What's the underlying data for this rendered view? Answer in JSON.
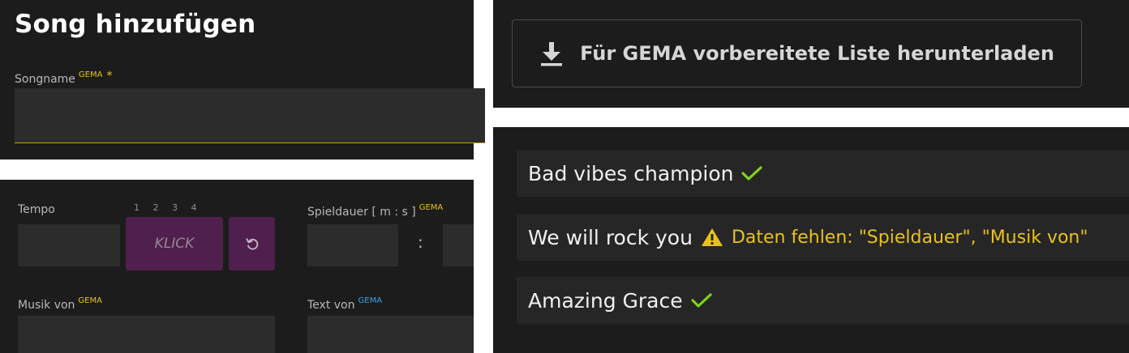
{
  "add_song": {
    "title": "Song hinzufügen",
    "songname_label": "Songname",
    "songname_gema": "GEMA",
    "required_mark": "*",
    "songname_value": "",
    "tempo_label": "Tempo",
    "tempo_value": "",
    "beats": [
      "1",
      "2",
      "3",
      "4"
    ],
    "klick_label": "KLICK",
    "duration_label": "Spieldauer [ m : s ]",
    "duration_gema": "GEMA",
    "duration_separator": ":",
    "musik_label": "Musik von",
    "musik_gema": "GEMA",
    "text_label": "Text von",
    "text_gema": "GEMA"
  },
  "download": {
    "label": "Für GEMA vorbereitete Liste herunterladen",
    "icon": "download-icon"
  },
  "songs": [
    {
      "name": "Bad vibes champion",
      "status": "ok"
    },
    {
      "name": "We will rock you",
      "status": "warning",
      "message": "Daten fehlen: \"Spieldauer\", \"Musik von\""
    },
    {
      "name": "Amazing Grace",
      "status": "ok"
    }
  ],
  "colors": {
    "ok": "#7ed321",
    "warning": "#e8c21b",
    "accent_purple": "#4f1f4d",
    "gema_blue": "#3aa3e8"
  }
}
